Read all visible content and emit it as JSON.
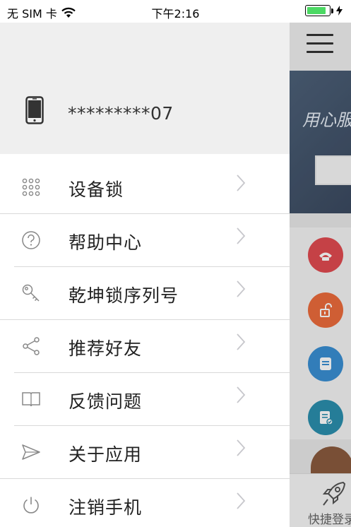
{
  "status_bar": {
    "carrier": "无 SIM 卡",
    "time": "下午2:16",
    "battery_level": 0.85,
    "battery_color": "#4cd964"
  },
  "drawer": {
    "phone_icon": "smartphone-icon",
    "phone_number": "*********07",
    "items": [
      {
        "label": "设备锁",
        "icon": "keypad-grid-icon"
      },
      {
        "label": "帮助中心",
        "icon": "help-circle-icon"
      },
      {
        "label": "乾坤锁序列号",
        "icon": "key-icon"
      },
      {
        "label": "推荐好友",
        "icon": "share-icon"
      },
      {
        "label": "反馈问题",
        "icon": "book-icon"
      },
      {
        "label": "关于应用",
        "icon": "send-icon"
      },
      {
        "label": "注销手机",
        "icon": "power-icon"
      }
    ]
  },
  "background_app": {
    "banner_text": "用心服",
    "tab_label": "快捷登录",
    "colors": {
      "red": "#e14b50",
      "orange": "#ec6b3c",
      "blue": "#3a8fd3",
      "teal": "#2b8fae"
    }
  }
}
